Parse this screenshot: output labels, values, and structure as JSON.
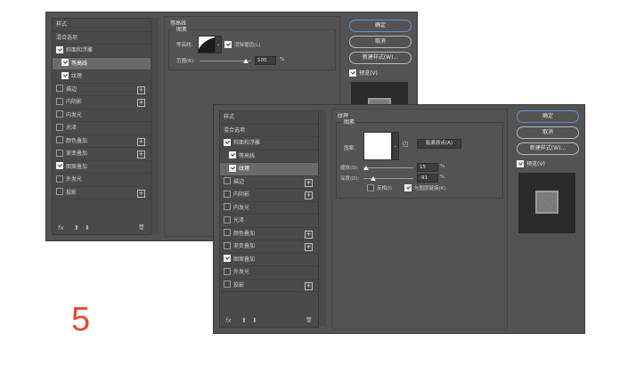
{
  "sidebar": {
    "title": "样式",
    "items": [
      {
        "label": "混合选项",
        "checkbox": false,
        "plus": false,
        "checked": false,
        "indent": false
      },
      {
        "label": "斜面和浮雕",
        "checkbox": true,
        "plus": false,
        "checked": true,
        "indent": false
      },
      {
        "label": "等高线",
        "checkbox": true,
        "plus": false,
        "checked": true,
        "indent": true
      },
      {
        "label": "纹理",
        "checkbox": true,
        "plus": false,
        "checked": true,
        "indent": true
      },
      {
        "label": "描边",
        "checkbox": true,
        "plus": true,
        "checked": false,
        "indent": false
      },
      {
        "label": "内阴影",
        "checkbox": true,
        "plus": true,
        "checked": false,
        "indent": false
      },
      {
        "label": "内发光",
        "checkbox": true,
        "plus": false,
        "checked": false,
        "indent": false
      },
      {
        "label": "光泽",
        "checkbox": true,
        "plus": false,
        "checked": false,
        "indent": false
      },
      {
        "label": "颜色叠加",
        "checkbox": true,
        "plus": true,
        "checked": false,
        "indent": false
      },
      {
        "label": "渐变叠加",
        "checkbox": true,
        "plus": true,
        "checked": false,
        "indent": false
      },
      {
        "label": "图案叠加",
        "checkbox": true,
        "plus": false,
        "checked": true,
        "indent": false
      },
      {
        "label": "外发光",
        "checkbox": true,
        "plus": false,
        "checked": false,
        "indent": false
      },
      {
        "label": "投影",
        "checkbox": true,
        "plus": true,
        "checked": false,
        "indent": false
      }
    ],
    "footer": {
      "fx": "fx",
      "up": "⬆",
      "down": "⬇",
      "trash": "🗑"
    }
  },
  "dialog1": {
    "selected_index": 2,
    "section_title": "等高线",
    "group_title": "图素",
    "contour_label": "等高线:",
    "antialias_label": "消除锯齿(L)",
    "range_label": "范围(R):",
    "range_value": "100",
    "range_unit": "%",
    "range_level": 0.9
  },
  "dialog2": {
    "selected_index": 3,
    "section_title": "纹理",
    "group_title": "图素",
    "pattern_label": "图案:",
    "snap_button": "贴紧原点(A)",
    "scale_label": "缩放(S):",
    "scale_value": "15",
    "depth_label": "深度(D):",
    "depth_value": "-91",
    "unit": "%",
    "invert_label": "反相(I)",
    "link_label": "与图层链接(K)",
    "scale_level": 0.05,
    "depth_level": 0.2
  },
  "buttons": {
    "ok": "确定",
    "cancel": "取消",
    "new_style": "新建样式(W)...",
    "preview": "预览(V)"
  },
  "step_number": "5"
}
